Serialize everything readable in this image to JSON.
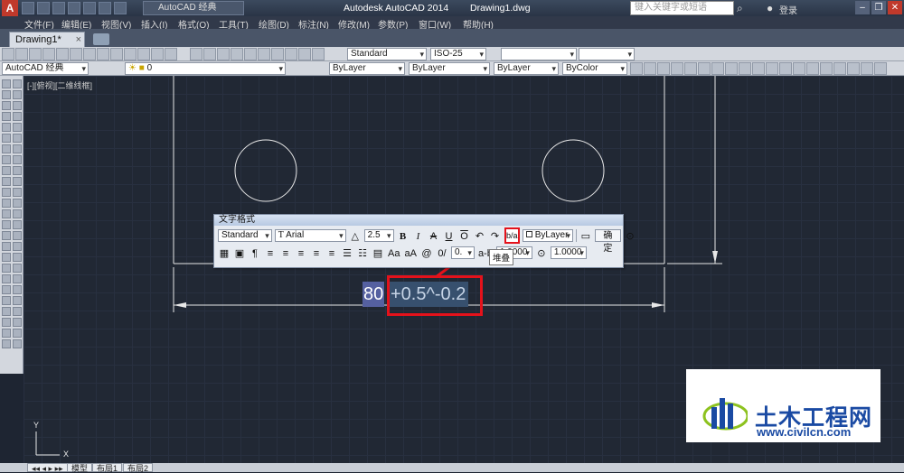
{
  "titlebar": {
    "workspace": "AutoCAD 经典",
    "app_title": "Autodesk AutoCAD 2014",
    "file_name": "Drawing1.dwg",
    "search_placeholder": "键入关键字或短语",
    "login": "登录"
  },
  "menubar": {
    "items": [
      "文件(F)",
      "编辑(E)",
      "视图(V)",
      "插入(I)",
      "格式(O)",
      "工具(T)",
      "绘图(D)",
      "标注(N)",
      "修改(M)",
      "参数(P)",
      "窗口(W)",
      "帮助(H)"
    ]
  },
  "tabs": {
    "doc_tab": "Drawing1*"
  },
  "toolbar1": {
    "text_style": "Standard",
    "dim_style": "ISO-25"
  },
  "toolbar2": {
    "workspace": "AutoCAD 经典",
    "layer": "0",
    "color": "ByLayer",
    "linetype": "ByLayer",
    "lineweight": "ByLayer",
    "plotstyle": "ByColor"
  },
  "canvas": {
    "viewport_label": "[-][俯视][二维线框]",
    "ucs_x": "X",
    "ucs_y": "Y"
  },
  "text_format": {
    "title": "文字格式",
    "style": "Standard",
    "font": "Arial",
    "height": "2.5",
    "bold": "B",
    "italic": "I",
    "strike": "A",
    "underline": "U",
    "overline": "O",
    "undo": "↶",
    "redo": "↷",
    "stack_glyph": "b/a",
    "color": "ByLayer",
    "ok": "确定",
    "oblique_value": "0.",
    "tracking": "1.0000",
    "width": "1.0000",
    "tooltip": "堆叠"
  },
  "mtext": {
    "main": "80",
    "tolerance": "+0.5^-0.2"
  },
  "statusbar": {
    "model_tab": "模型",
    "layout1": "布局1",
    "layout2": "布局2"
  },
  "watermark": {
    "title": "土木工程网",
    "url": "www.civilcn.com"
  },
  "colors": {
    "highlight_red": "#e4121b",
    "canvas_bg": "#212834"
  }
}
